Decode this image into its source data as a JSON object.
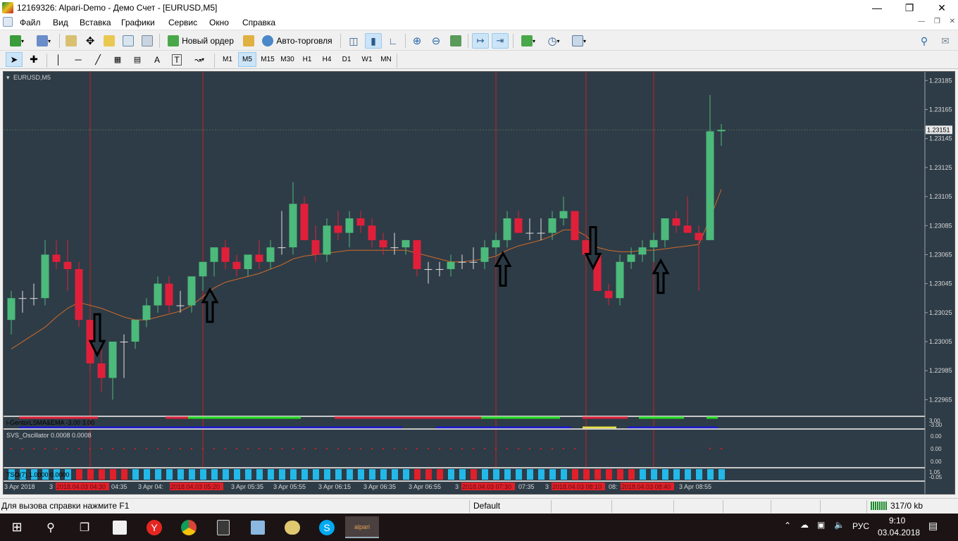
{
  "window": {
    "title": "12169326: Alpari-Demo - Демо Счет - [EURUSD,M5]"
  },
  "menu": [
    "Файл",
    "Вид",
    "Вставка",
    "Графики",
    "Сервис",
    "Окно",
    "Справка"
  ],
  "toolbar": {
    "new_order": "Новый ордер",
    "auto_trading": "Авто-торговля"
  },
  "timeframes": [
    "M1",
    "M5",
    "M15",
    "M30",
    "H1",
    "H4",
    "D1",
    "W1",
    "MN"
  ],
  "selected_timeframe": "M5",
  "chart": {
    "symbol_label": "EURUSD,M5",
    "price_levels": [
      "1.23185",
      "1.23165",
      "1.23145",
      "1.23125",
      "1.23105",
      "1.23085",
      "1.23065",
      "1.23045",
      "1.23025",
      "1.23005",
      "1.22985",
      "1.22965"
    ],
    "current_price": "1.23151",
    "indicator1_label": "i-GentorLSMA&EMA -3.00 3.00",
    "indicator1_scale": [
      "3.00",
      "-3.00"
    ],
    "indicator2_label": "SVS_Oscillator 0.0008 0.0008",
    "indicator2_scale": [
      "0.00",
      "0.00",
      "0.00"
    ],
    "indicator3_label": "TSO(7) 1.0000 0.0000",
    "indicator3_scale": [
      "1.05",
      "-0.05"
    ],
    "time_labels": [
      "3 Apr 2018",
      "3",
      "2018.04.03 04:30",
      "04:35",
      "3 Apr 04:",
      "2018.04.03 05:20",
      "3 Apr 05:35",
      "3 Apr 05:55",
      "3 Apr 06:15",
      "3 Apr 06:35",
      "3 Apr 06:55",
      "3",
      "2018.04.03 07:30",
      "07:35",
      "3",
      "2018.04.03 08:10",
      "08:",
      "2018.04.03 08:40",
      "3 Apr 08:55"
    ],
    "colors": {
      "background": "#2e3c47",
      "bull": "#4cba7a",
      "bear": "#e0203a",
      "ma": "#d06a2a",
      "vline": "#c82020"
    }
  },
  "chart_data": {
    "type": "candlestick",
    "symbol": "EURUSD",
    "timeframe": "M5",
    "ylim": [
      1.22955,
      1.2319
    ],
    "candles": [
      {
        "o": 1.2302,
        "h": 1.2304,
        "l": 1.2301,
        "c": 1.23035
      },
      {
        "o": 1.23035,
        "h": 1.2304,
        "l": 1.23025,
        "c": 1.23035
      },
      {
        "o": 1.23035,
        "h": 1.23045,
        "l": 1.2303,
        "c": 1.23035
      },
      {
        "o": 1.23035,
        "h": 1.23075,
        "l": 1.2303,
        "c": 1.23065
      },
      {
        "o": 1.23065,
        "h": 1.23075,
        "l": 1.23055,
        "c": 1.2306
      },
      {
        "o": 1.2306,
        "h": 1.23075,
        "l": 1.2304,
        "c": 1.23055
      },
      {
        "o": 1.23055,
        "h": 1.2306,
        "l": 1.23015,
        "c": 1.2302
      },
      {
        "o": 1.2302,
        "h": 1.2302,
        "l": 1.22985,
        "c": 1.2299
      },
      {
        "o": 1.2299,
        "h": 1.23,
        "l": 1.2297,
        "c": 1.2298
      },
      {
        "o": 1.2298,
        "h": 1.23005,
        "l": 1.22965,
        "c": 1.23005
      },
      {
        "o": 1.23005,
        "h": 1.2301,
        "l": 1.2298,
        "c": 1.23005
      },
      {
        "o": 1.23005,
        "h": 1.2302,
        "l": 1.23,
        "c": 1.2302
      },
      {
        "o": 1.2302,
        "h": 1.23035,
        "l": 1.23015,
        "c": 1.2303
      },
      {
        "o": 1.2303,
        "h": 1.2305,
        "l": 1.23025,
        "c": 1.23045
      },
      {
        "o": 1.23045,
        "h": 1.2305,
        "l": 1.23025,
        "c": 1.2303
      },
      {
        "o": 1.2303,
        "h": 1.2304,
        "l": 1.23025,
        "c": 1.2303
      },
      {
        "o": 1.2303,
        "h": 1.2305,
        "l": 1.23025,
        "c": 1.2305
      },
      {
        "o": 1.2305,
        "h": 1.2306,
        "l": 1.2304,
        "c": 1.2306
      },
      {
        "o": 1.2306,
        "h": 1.23065,
        "l": 1.2305,
        "c": 1.2307
      },
      {
        "o": 1.2307,
        "h": 1.23075,
        "l": 1.23055,
        "c": 1.2306
      },
      {
        "o": 1.2306,
        "h": 1.23065,
        "l": 1.2305,
        "c": 1.23055
      },
      {
        "o": 1.23055,
        "h": 1.23065,
        "l": 1.2305,
        "c": 1.23065
      },
      {
        "o": 1.23065,
        "h": 1.23075,
        "l": 1.23055,
        "c": 1.2306
      },
      {
        "o": 1.2306,
        "h": 1.23075,
        "l": 1.23055,
        "c": 1.2307
      },
      {
        "o": 1.2307,
        "h": 1.23095,
        "l": 1.23065,
        "c": 1.2307
      },
      {
        "o": 1.2307,
        "h": 1.23115,
        "l": 1.23065,
        "c": 1.231
      },
      {
        "o": 1.231,
        "h": 1.23105,
        "l": 1.23075,
        "c": 1.23075
      },
      {
        "o": 1.23075,
        "h": 1.23085,
        "l": 1.2306,
        "c": 1.23065
      },
      {
        "o": 1.23065,
        "h": 1.2309,
        "l": 1.2306,
        "c": 1.23085
      },
      {
        "o": 1.23085,
        "h": 1.23095,
        "l": 1.23075,
        "c": 1.2308
      },
      {
        "o": 1.2308,
        "h": 1.23095,
        "l": 1.2307,
        "c": 1.2309
      },
      {
        "o": 1.2309,
        "h": 1.23095,
        "l": 1.2308,
        "c": 1.23085
      },
      {
        "o": 1.23085,
        "h": 1.2309,
        "l": 1.2307,
        "c": 1.23075
      },
      {
        "o": 1.23075,
        "h": 1.2308,
        "l": 1.23065,
        "c": 1.2307
      },
      {
        "o": 1.2307,
        "h": 1.2308,
        "l": 1.23065,
        "c": 1.2307
      },
      {
        "o": 1.2307,
        "h": 1.23075,
        "l": 1.23065,
        "c": 1.23075
      },
      {
        "o": 1.23075,
        "h": 1.23075,
        "l": 1.2305,
        "c": 1.23055
      },
      {
        "o": 1.23055,
        "h": 1.2306,
        "l": 1.23045,
        "c": 1.23055
      },
      {
        "o": 1.23055,
        "h": 1.2306,
        "l": 1.2305,
        "c": 1.23055
      },
      {
        "o": 1.23055,
        "h": 1.23065,
        "l": 1.2305,
        "c": 1.2306
      },
      {
        "o": 1.2306,
        "h": 1.23065,
        "l": 1.23055,
        "c": 1.2306
      },
      {
        "o": 1.2306,
        "h": 1.2307,
        "l": 1.23055,
        "c": 1.2306
      },
      {
        "o": 1.2306,
        "h": 1.23075,
        "l": 1.23055,
        "c": 1.2307
      },
      {
        "o": 1.2307,
        "h": 1.2308,
        "l": 1.23065,
        "c": 1.23075
      },
      {
        "o": 1.23075,
        "h": 1.23095,
        "l": 1.2307,
        "c": 1.2309
      },
      {
        "o": 1.2309,
        "h": 1.23095,
        "l": 1.2308,
        "c": 1.2308
      },
      {
        "o": 1.2308,
        "h": 1.2309,
        "l": 1.23075,
        "c": 1.2308
      },
      {
        "o": 1.2308,
        "h": 1.2309,
        "l": 1.23075,
        "c": 1.2308
      },
      {
        "o": 1.2308,
        "h": 1.23095,
        "l": 1.23075,
        "c": 1.2309
      },
      {
        "o": 1.2309,
        "h": 1.23105,
        "l": 1.23085,
        "c": 1.23095
      },
      {
        "o": 1.23095,
        "h": 1.23095,
        "l": 1.23075,
        "c": 1.23075
      },
      {
        "o": 1.23075,
        "h": 1.2308,
        "l": 1.2306,
        "c": 1.23065
      },
      {
        "o": 1.23065,
        "h": 1.23065,
        "l": 1.2304,
        "c": 1.2304
      },
      {
        "o": 1.2304,
        "h": 1.23045,
        "l": 1.2303,
        "c": 1.23035
      },
      {
        "o": 1.23035,
        "h": 1.23065,
        "l": 1.2303,
        "c": 1.2306
      },
      {
        "o": 1.2306,
        "h": 1.2307,
        "l": 1.23055,
        "c": 1.23065
      },
      {
        "o": 1.23065,
        "h": 1.23075,
        "l": 1.2306,
        "c": 1.2307
      },
      {
        "o": 1.2307,
        "h": 1.2308,
        "l": 1.2306,
        "c": 1.23075
      },
      {
        "o": 1.23075,
        "h": 1.2309,
        "l": 1.2307,
        "c": 1.2309
      },
      {
        "o": 1.2309,
        "h": 1.23095,
        "l": 1.2308,
        "c": 1.23085
      },
      {
        "o": 1.23085,
        "h": 1.23105,
        "l": 1.2308,
        "c": 1.2308
      },
      {
        "o": 1.2308,
        "h": 1.23085,
        "l": 1.2304,
        "c": 1.23075
      },
      {
        "o": 1.23075,
        "h": 1.23175,
        "l": 1.23075,
        "c": 1.2315
      },
      {
        "o": 1.2315,
        "h": 1.23155,
        "l": 1.2314,
        "c": 1.23151
      }
    ],
    "moving_average": [
      1.23,
      1.23005,
      1.2301,
      1.23015,
      1.23022,
      1.23028,
      1.23032,
      1.2303,
      1.23028,
      1.23025,
      1.23022,
      1.2302,
      1.2302,
      1.23022,
      1.23024,
      1.23026,
      1.2303,
      1.23036,
      1.23042,
      1.23046,
      1.23048,
      1.2305,
      1.23052,
      1.23055,
      1.23058,
      1.23062,
      1.23064,
      1.23065,
      1.23066,
      1.23067,
      1.23068,
      1.23068,
      1.23068,
      1.23068,
      1.23068,
      1.23068,
      1.23066,
      1.23064,
      1.23062,
      1.2306,
      1.2306,
      1.23061,
      1.23062,
      1.23064,
      1.23068,
      1.23071,
      1.23073,
      1.23075,
      1.23078,
      1.23082,
      1.23082,
      1.23078,
      1.2307,
      1.23068,
      1.23067,
      1.23067,
      1.23068,
      1.23068,
      1.23069,
      1.2307,
      1.23071,
      1.23072,
      1.2309,
      1.2311
    ],
    "signals": [
      {
        "index": 7,
        "direction": "down"
      },
      {
        "index": 17,
        "direction": "up"
      },
      {
        "index": 43,
        "direction": "up"
      },
      {
        "index": 51,
        "direction": "down"
      },
      {
        "index": 57,
        "direction": "up"
      }
    ],
    "vertical_lines": [
      7,
      17,
      43,
      51,
      57
    ]
  }
}
